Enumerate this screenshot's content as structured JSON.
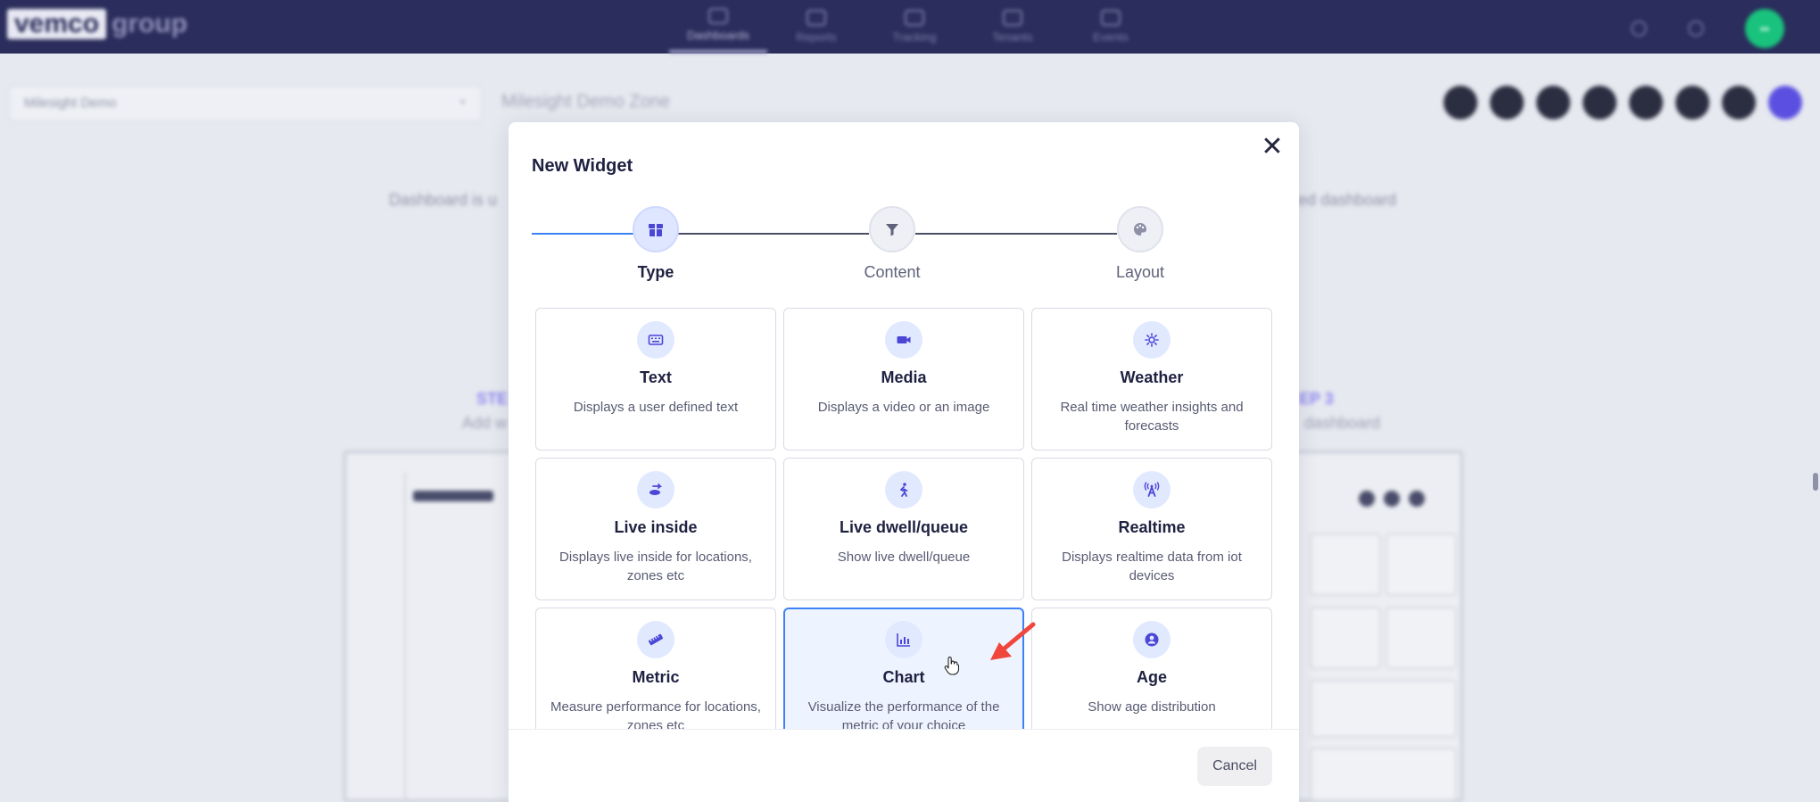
{
  "app": {
    "logo_part1": "vemco",
    "logo_part2": "group",
    "nav": [
      {
        "label": "Dashboards",
        "active": true
      },
      {
        "label": "Reports",
        "active": false
      },
      {
        "label": "Tracking",
        "active": false
      },
      {
        "label": "Tenants",
        "active": false
      },
      {
        "label": "Events",
        "active": false
      }
    ],
    "avatar_initials": "••"
  },
  "background": {
    "dashboard_select": "Milesight Demo",
    "zone_title": "Milesight Demo Zone",
    "intro_left": "Dashboard is u",
    "intro_right": "ized dashboard",
    "step1_label": "STE",
    "step1_sub": "Add w",
    "step3_label": "EP 3",
    "step3_sub": "dashboard"
  },
  "modal": {
    "title": "New Widget",
    "steps": [
      {
        "label": "Type",
        "icon": "widget-box-icon",
        "active": true
      },
      {
        "label": "Content",
        "icon": "filter-icon",
        "active": false
      },
      {
        "label": "Layout",
        "icon": "palette-icon",
        "active": false
      }
    ],
    "cards": [
      {
        "title": "Text",
        "desc": "Displays a user defined text",
        "icon": "text-keyboard-icon",
        "selected": false
      },
      {
        "title": "Media",
        "desc": "Displays a video or an image",
        "icon": "video-camera-icon",
        "selected": false
      },
      {
        "title": "Weather",
        "desc": "Real time weather insights and forecasts",
        "icon": "sun-gear-icon",
        "selected": false
      },
      {
        "title": "Live inside",
        "desc": "Displays live inside for locations, zones etc",
        "icon": "live-inside-icon",
        "selected": false
      },
      {
        "title": "Live dwell/queue",
        "desc": "Show live dwell/queue",
        "icon": "walking-person-icon",
        "selected": false
      },
      {
        "title": "Realtime",
        "desc": "Displays realtime data from iot devices",
        "icon": "broadcast-tower-icon",
        "selected": false
      },
      {
        "title": "Metric",
        "desc": "Measure performance for locations, zones etc",
        "icon": "ruler-icon",
        "selected": false
      },
      {
        "title": "Chart",
        "desc": "Visualize the performance of the metric of your choice",
        "icon": "bar-chart-icon",
        "selected": true
      },
      {
        "title": "Age",
        "desc": "Show age distribution",
        "icon": "user-circle-icon",
        "selected": false
      }
    ],
    "cancel_label": "Cancel"
  },
  "colors": {
    "topbar": "#2b2d5c",
    "accent_blue": "#3c82f6",
    "icon_purple": "#4b46d6",
    "annotation_red": "#f0463c"
  }
}
